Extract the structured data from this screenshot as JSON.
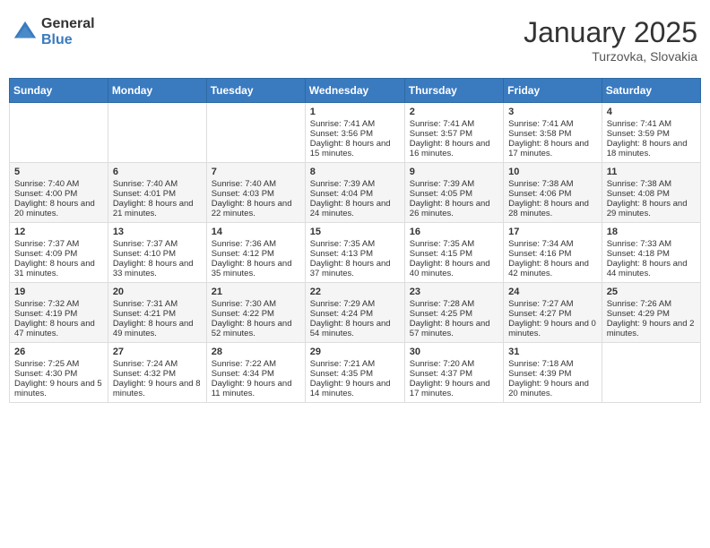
{
  "logo": {
    "general": "General",
    "blue": "Blue"
  },
  "title": "January 2025",
  "location": "Turzovka, Slovakia",
  "days_header": [
    "Sunday",
    "Monday",
    "Tuesday",
    "Wednesday",
    "Thursday",
    "Friday",
    "Saturday"
  ],
  "weeks": [
    [
      {
        "day": "",
        "content": ""
      },
      {
        "day": "",
        "content": ""
      },
      {
        "day": "",
        "content": ""
      },
      {
        "day": "1",
        "content": "Sunrise: 7:41 AM\nSunset: 3:56 PM\nDaylight: 8 hours and 15 minutes."
      },
      {
        "day": "2",
        "content": "Sunrise: 7:41 AM\nSunset: 3:57 PM\nDaylight: 8 hours and 16 minutes."
      },
      {
        "day": "3",
        "content": "Sunrise: 7:41 AM\nSunset: 3:58 PM\nDaylight: 8 hours and 17 minutes."
      },
      {
        "day": "4",
        "content": "Sunrise: 7:41 AM\nSunset: 3:59 PM\nDaylight: 8 hours and 18 minutes."
      }
    ],
    [
      {
        "day": "5",
        "content": "Sunrise: 7:40 AM\nSunset: 4:00 PM\nDaylight: 8 hours and 20 minutes."
      },
      {
        "day": "6",
        "content": "Sunrise: 7:40 AM\nSunset: 4:01 PM\nDaylight: 8 hours and 21 minutes."
      },
      {
        "day": "7",
        "content": "Sunrise: 7:40 AM\nSunset: 4:03 PM\nDaylight: 8 hours and 22 minutes."
      },
      {
        "day": "8",
        "content": "Sunrise: 7:39 AM\nSunset: 4:04 PM\nDaylight: 8 hours and 24 minutes."
      },
      {
        "day": "9",
        "content": "Sunrise: 7:39 AM\nSunset: 4:05 PM\nDaylight: 8 hours and 26 minutes."
      },
      {
        "day": "10",
        "content": "Sunrise: 7:38 AM\nSunset: 4:06 PM\nDaylight: 8 hours and 28 minutes."
      },
      {
        "day": "11",
        "content": "Sunrise: 7:38 AM\nSunset: 4:08 PM\nDaylight: 8 hours and 29 minutes."
      }
    ],
    [
      {
        "day": "12",
        "content": "Sunrise: 7:37 AM\nSunset: 4:09 PM\nDaylight: 8 hours and 31 minutes."
      },
      {
        "day": "13",
        "content": "Sunrise: 7:37 AM\nSunset: 4:10 PM\nDaylight: 8 hours and 33 minutes."
      },
      {
        "day": "14",
        "content": "Sunrise: 7:36 AM\nSunset: 4:12 PM\nDaylight: 8 hours and 35 minutes."
      },
      {
        "day": "15",
        "content": "Sunrise: 7:35 AM\nSunset: 4:13 PM\nDaylight: 8 hours and 37 minutes."
      },
      {
        "day": "16",
        "content": "Sunrise: 7:35 AM\nSunset: 4:15 PM\nDaylight: 8 hours and 40 minutes."
      },
      {
        "day": "17",
        "content": "Sunrise: 7:34 AM\nSunset: 4:16 PM\nDaylight: 8 hours and 42 minutes."
      },
      {
        "day": "18",
        "content": "Sunrise: 7:33 AM\nSunset: 4:18 PM\nDaylight: 8 hours and 44 minutes."
      }
    ],
    [
      {
        "day": "19",
        "content": "Sunrise: 7:32 AM\nSunset: 4:19 PM\nDaylight: 8 hours and 47 minutes."
      },
      {
        "day": "20",
        "content": "Sunrise: 7:31 AM\nSunset: 4:21 PM\nDaylight: 8 hours and 49 minutes."
      },
      {
        "day": "21",
        "content": "Sunrise: 7:30 AM\nSunset: 4:22 PM\nDaylight: 8 hours and 52 minutes."
      },
      {
        "day": "22",
        "content": "Sunrise: 7:29 AM\nSunset: 4:24 PM\nDaylight: 8 hours and 54 minutes."
      },
      {
        "day": "23",
        "content": "Sunrise: 7:28 AM\nSunset: 4:25 PM\nDaylight: 8 hours and 57 minutes."
      },
      {
        "day": "24",
        "content": "Sunrise: 7:27 AM\nSunset: 4:27 PM\nDaylight: 9 hours and 0 minutes."
      },
      {
        "day": "25",
        "content": "Sunrise: 7:26 AM\nSunset: 4:29 PM\nDaylight: 9 hours and 2 minutes."
      }
    ],
    [
      {
        "day": "26",
        "content": "Sunrise: 7:25 AM\nSunset: 4:30 PM\nDaylight: 9 hours and 5 minutes."
      },
      {
        "day": "27",
        "content": "Sunrise: 7:24 AM\nSunset: 4:32 PM\nDaylight: 9 hours and 8 minutes."
      },
      {
        "day": "28",
        "content": "Sunrise: 7:22 AM\nSunset: 4:34 PM\nDaylight: 9 hours and 11 minutes."
      },
      {
        "day": "29",
        "content": "Sunrise: 7:21 AM\nSunset: 4:35 PM\nDaylight: 9 hours and 14 minutes."
      },
      {
        "day": "30",
        "content": "Sunrise: 7:20 AM\nSunset: 4:37 PM\nDaylight: 9 hours and 17 minutes."
      },
      {
        "day": "31",
        "content": "Sunrise: 7:18 AM\nSunset: 4:39 PM\nDaylight: 9 hours and 20 minutes."
      },
      {
        "day": "",
        "content": ""
      }
    ]
  ]
}
